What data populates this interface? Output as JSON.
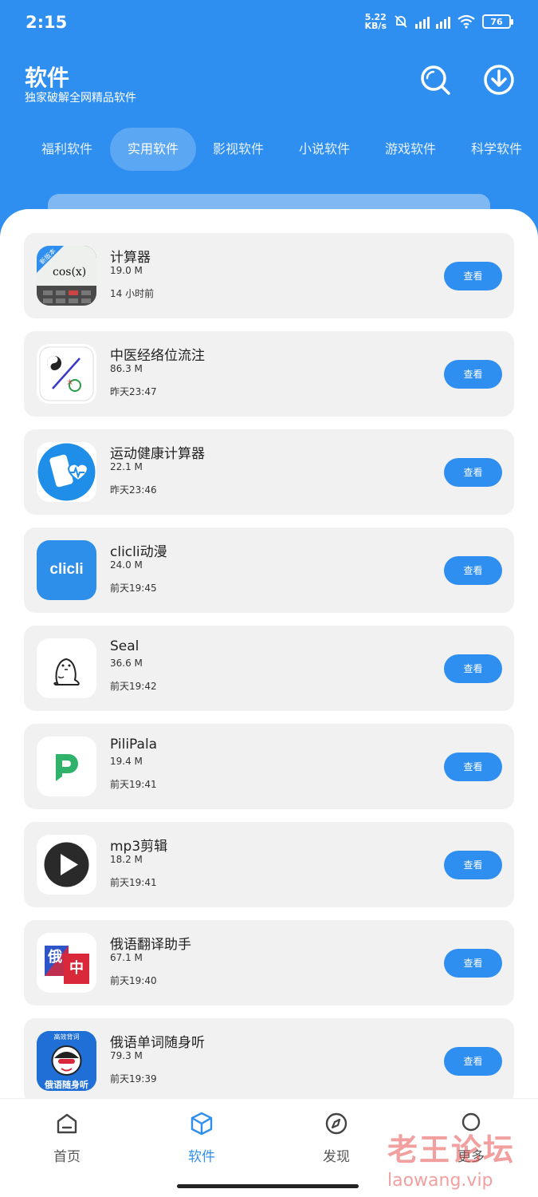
{
  "status_bar": {
    "time": "2:15",
    "net_speed_value": "5.22",
    "net_speed_unit": "KB/s",
    "battery": "76"
  },
  "header": {
    "title": "软件",
    "subtitle": "独家破解全网精品软件",
    "search_icon": "search-icon",
    "download_icon": "download-icon"
  },
  "tabs": [
    {
      "label": "福利软件",
      "active": false
    },
    {
      "label": "实用软件",
      "active": true
    },
    {
      "label": "影视软件",
      "active": false
    },
    {
      "label": "小说软件",
      "active": false
    },
    {
      "label": "游戏软件",
      "active": false
    },
    {
      "label": "科学软件",
      "active": false
    }
  ],
  "apps": [
    {
      "name": "计算器",
      "size": "19.0 M",
      "time": "14 小时前",
      "button": "查看",
      "icon_badge": "新版本",
      "icon_text": "cos(x)"
    },
    {
      "name": "中医经络位流注",
      "size": "86.3 M",
      "time": "昨天23:47",
      "button": "查看"
    },
    {
      "name": "运动健康计算器",
      "size": "22.1 M",
      "time": "昨天23:46",
      "button": "查看"
    },
    {
      "name": "clicli动漫",
      "size": "24.0 M",
      "time": "前天19:45",
      "button": "查看",
      "icon_text": "clicli"
    },
    {
      "name": "Seal",
      "size": "36.6 M",
      "time": "前天19:42",
      "button": "查看"
    },
    {
      "name": "PiliPala",
      "size": "19.4 M",
      "time": "前天19:41",
      "button": "查看"
    },
    {
      "name": "mp3剪辑",
      "size": "18.2 M",
      "time": "前天19:41",
      "button": "查看"
    },
    {
      "name": "俄语翻译助手",
      "size": "67.1 M",
      "time": "前天19:40",
      "button": "查看",
      "icon_text_1": "俄",
      "icon_text_2": "中"
    },
    {
      "name": "俄语单词随身听",
      "size": "79.3 M",
      "time": "前天19:39",
      "button": "查看",
      "icon_text_top": "高效背词",
      "icon_text_bottom": "俄语随身听"
    }
  ],
  "bottom_nav": [
    {
      "label": "首页",
      "icon": "home-icon",
      "active": false
    },
    {
      "label": "软件",
      "icon": "cube-icon",
      "active": true
    },
    {
      "label": "发现",
      "icon": "compass-icon",
      "active": false
    },
    {
      "label": "更多",
      "icon": "circle-icon",
      "active": false
    }
  ],
  "watermark": {
    "cn": "老王论坛",
    "en": "laowang.vip"
  },
  "colors": {
    "primary": "#2f8ff0",
    "card_bg": "#f1f1f1"
  }
}
